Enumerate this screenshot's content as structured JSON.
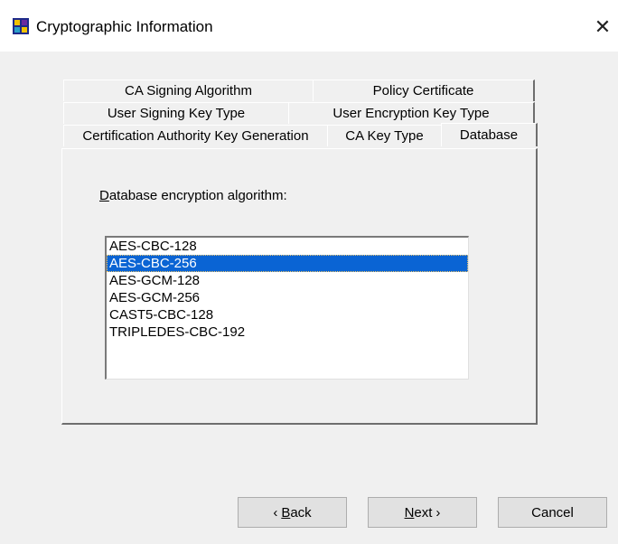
{
  "window": {
    "title": "Cryptographic Information",
    "close_label": "✕"
  },
  "tabs": {
    "row1": [
      {
        "label": "CA Signing Algorithm"
      },
      {
        "label": "Policy Certificate"
      }
    ],
    "row2": [
      {
        "label": "User Signing Key Type"
      },
      {
        "label": "User Encryption Key Type"
      }
    ],
    "row3": [
      {
        "label": "Certification Authority Key Generation"
      },
      {
        "label": "CA Key Type"
      },
      {
        "label": "Database",
        "active": true
      }
    ]
  },
  "panel": {
    "label_prefix": "D",
    "label_rest": "atabase encryption algorithm:",
    "options": [
      "AES-CBC-128",
      "AES-CBC-256",
      "AES-GCM-128",
      "AES-GCM-256",
      "CAST5-CBC-128",
      "TRIPLEDES-CBC-192"
    ],
    "selected": "AES-CBC-256"
  },
  "buttons": {
    "back_arrow": "‹",
    "back_mnemonic": "B",
    "back_rest": "ack",
    "next_mnemonic": "N",
    "next_rest": "ext",
    "next_arrow": "›",
    "cancel": "Cancel"
  }
}
